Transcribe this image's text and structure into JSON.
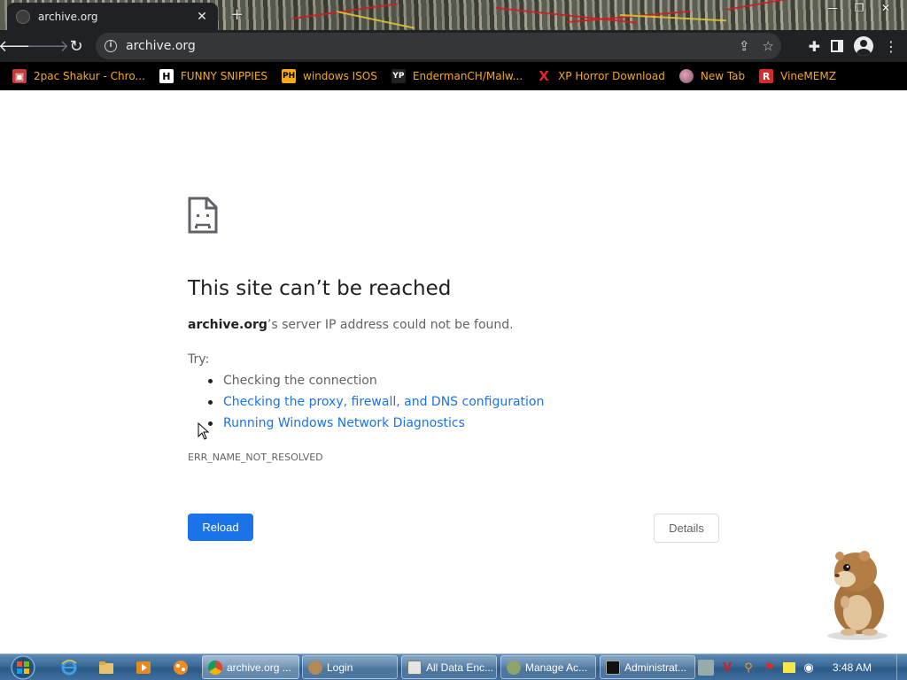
{
  "browser": {
    "tab": {
      "title": "archive.org",
      "close_icon": "close-icon"
    },
    "window_controls": [
      "minimize",
      "restore",
      "close"
    ],
    "address_bar": {
      "url": "archive.org"
    },
    "bookmarks": [
      {
        "label": "2pac Shakur - Chro...",
        "icon": "bookmark-favicon",
        "color": "#f6a91b"
      },
      {
        "label": "FUNNY SNIPPIES",
        "icon": "H"
      },
      {
        "label": "windows ISOS",
        "icon": "PH"
      },
      {
        "label": "EndermanCH/Malw...",
        "icon": "YP"
      },
      {
        "label": "XP Horror Download",
        "icon": "X"
      },
      {
        "label": "New Tab",
        "icon": "globe-icon"
      },
      {
        "label": "VineMEMZ",
        "icon": "R"
      }
    ]
  },
  "error_page": {
    "title": "This site can’t be reached",
    "description_host": "archive.org",
    "description_rest": "’s server IP address could not be found.",
    "try_label": "Try:",
    "suggestions": [
      "Checking the connection",
      "Checking the proxy, firewall, and DNS configuration",
      "Running Windows Network Diagnostics"
    ],
    "error_code": "ERR_NAME_NOT_RESOLVED",
    "reload_label": "Reload",
    "details_label": "Details",
    "accent": "#1a73e8"
  },
  "taskbar": {
    "tasks": [
      {
        "label": "archive.org ...",
        "icon": "chrome-icon",
        "active": true
      },
      {
        "label": "Login",
        "icon": "app-icon"
      },
      {
        "label": "All Data Enc...",
        "icon": "window-icon"
      },
      {
        "label": "Manage Ac...",
        "icon": "users-icon"
      },
      {
        "label": "Administrat...",
        "icon": "cmd-icon"
      }
    ],
    "clock": "3:48 AM"
  }
}
